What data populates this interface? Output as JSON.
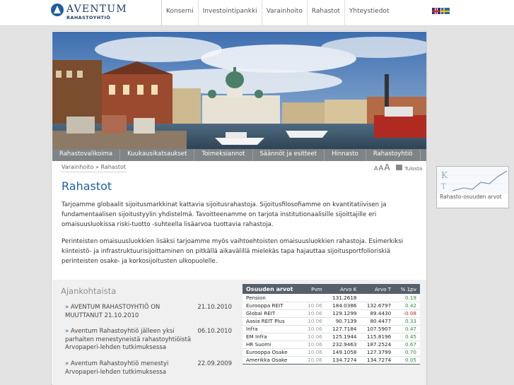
{
  "brand": {
    "name": "AVENTUM",
    "subtitle": "RAHASTOYHTIÖ"
  },
  "topnav": [
    "Konserni",
    "Investointipankki",
    "Varainhoito",
    "Rahastot",
    "Yhteystiedot"
  ],
  "languages": [
    "english-flag-icon",
    "swedish-flag-icon"
  ],
  "subnav": [
    "Rahastovalikoima",
    "Kuukausikatsaukset",
    "Toimeksiannot",
    "Säännöt ja esitteet",
    "Hinnasto",
    "Rahastoyhtiö"
  ],
  "breadcrumb": "Varainhoito » Rahastot",
  "tools": {
    "size_small": "A",
    "size_medium": "A",
    "size_large": "A",
    "print": "Tulosta"
  },
  "page": {
    "title": "Rahastot",
    "p1": "Tarjoamme globaalit sijoitusmarkkinat kattavia sijoitusrahastoja. Sijoitusfilosofiamme on kvantitatiivisen ja fundamentaalisen sijoitustyylin yhdistelmä. Tavoitteenamme on tarjota institutionaalisille sijoittajille eri omaisuusluokissa riski-tuotto -suhteella lisäarvoa tuottavia rahastoja.",
    "p2": "Perinteisten omaisuusluokkien lisäksi tarjoamme myös vaihtoehtoisten omaisuusluokkien rahastoja. Esimerkiksi kiinteistö- ja infrastruktuurisijoittaminen on pitkällä aikavälillä mielekäs tapa hajauttaa sijoitusportfolioriskiä perinteisten osake- ja korkosijoitusten ulkopuolelle."
  },
  "news": {
    "title": "Ajankohtaista",
    "items": [
      {
        "text": "AVENTUM RAHASTOYHTIÖ ON MUUTTANUT 21.10.2010",
        "date": "21.10.2010"
      },
      {
        "text": "Aventum Rahastoyhtiö jälleen yksi parhaiten menestyneistä rahastoyhtiöistä Arvopaperi-lehden tutkimuksessa",
        "date": "06.10.2010"
      },
      {
        "text": "Aventum Rahastoyhtiö menestyi Arvopaperi-lehden tutkimuksessa",
        "date": "22.09.2009"
      }
    ]
  },
  "fund_table": {
    "headers": [
      "Osuuden arvot",
      "Pvm",
      "Arvo K",
      "Arvo T",
      "% 1pv"
    ],
    "rows": [
      [
        "Pension",
        "",
        "131.2618",
        "",
        "0.19"
      ],
      [
        "Eurooppa REIT",
        "10.06",
        "184.0386",
        "132.6797",
        "0.42"
      ],
      [
        "Global REIT",
        "10.06",
        "129.1299",
        "89.4430",
        "-0.08"
      ],
      [
        "Aasia REIT Plus",
        "10.06",
        "90.7139",
        "80.4477",
        "0.33"
      ],
      [
        "Infra",
        "10.06",
        "127.7184",
        "107.5907",
        "0.47"
      ],
      [
        "EM Infra",
        "10.06",
        "125.1944",
        "115.8196",
        "0.45"
      ],
      [
        "HR Suomi",
        "10.06",
        "232.9463",
        "187.2524",
        "0.67"
      ],
      [
        "Eurooppa Osake",
        "10.06",
        "149.1058",
        "127.3799",
        "0.70"
      ],
      [
        "Amerikka Osake",
        "10.06",
        "134.7274",
        "134.7274",
        "0.05"
      ]
    ],
    "colors": {
      "positive": "#2e8b3c",
      "negative": "#c8281e",
      "header": "#56606a"
    }
  },
  "sidebox": {
    "logo": "KT",
    "label": "Rahasto-osuuden arvot"
  },
  "colors": {
    "brand": "#1f5f9e",
    "subnav": "#7f8486",
    "background": "#e3e3e3"
  }
}
